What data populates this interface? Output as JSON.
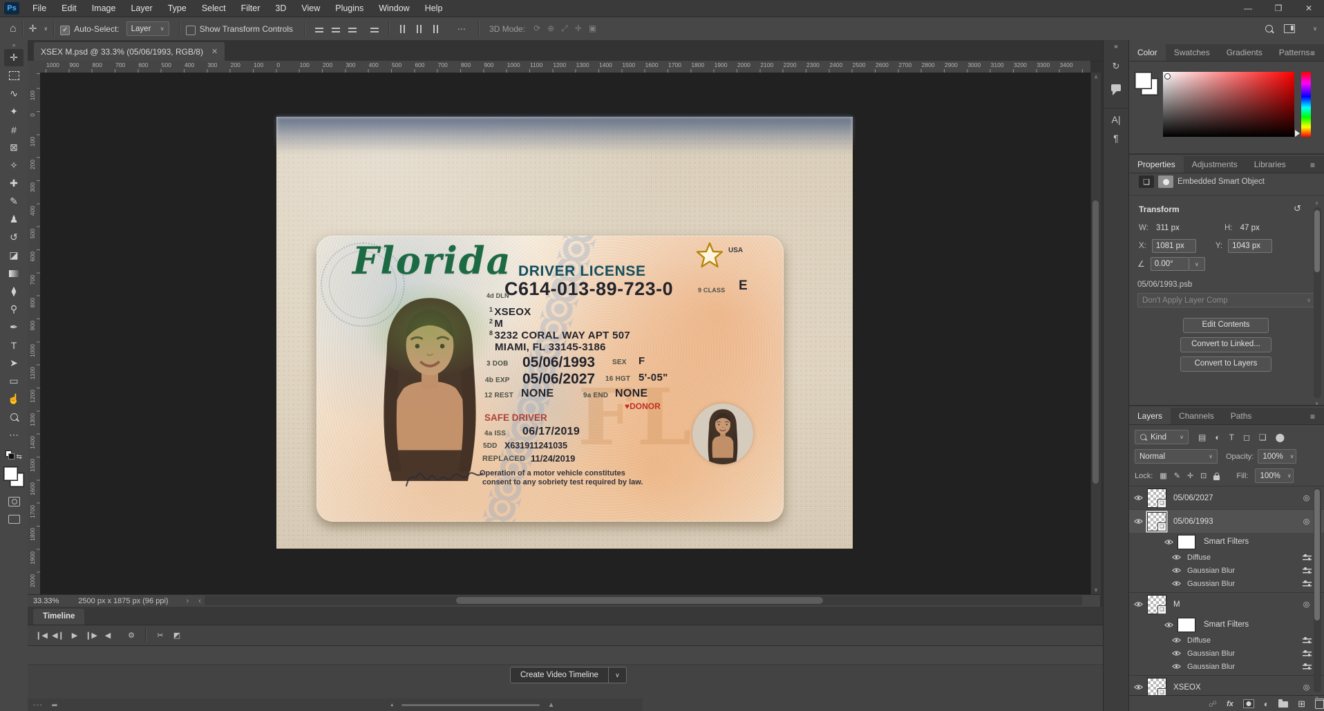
{
  "window": {
    "logo": "Ps",
    "menus": [
      "File",
      "Edit",
      "Image",
      "Layer",
      "Type",
      "Select",
      "Filter",
      "3D",
      "View",
      "Plugins",
      "Window",
      "Help"
    ],
    "controls": [
      "minimize",
      "restore",
      "close"
    ]
  },
  "options_bar": {
    "auto_select": "Auto-Select:",
    "target": "Layer",
    "show_transform": "Show Transform Controls",
    "mode_label": "3D Mode:"
  },
  "doc_tab": "XSEX M.psd @ 33.3% (05/06/1993, RGB/8)",
  "status": {
    "zoom": "33.33%",
    "dims": "2500 px x 1875 px (96 ppi)"
  },
  "rulers": {
    "h": [
      "1000",
      "900",
      "800",
      "700",
      "600",
      "500",
      "400",
      "300",
      "200",
      "100",
      "0",
      "100",
      "200",
      "300",
      "400",
      "500",
      "600",
      "700",
      "800",
      "900",
      "1000",
      "1100",
      "1200",
      "1300",
      "1400",
      "1500",
      "1600",
      "1700",
      "1800",
      "1900",
      "2000",
      "2100",
      "2200",
      "2300",
      "2400",
      "2500",
      "2600",
      "2700",
      "2800",
      "2900",
      "3000",
      "3100",
      "3200",
      "3300",
      "3400"
    ],
    "v": [
      "100",
      "0",
      "100",
      "200",
      "300",
      "400",
      "500",
      "600",
      "700",
      "800",
      "900",
      "1000",
      "1100",
      "1200",
      "1300",
      "1400",
      "1500",
      "1600",
      "1700",
      "1800",
      "1900",
      "2000"
    ]
  },
  "toolbar": {
    "tools": [
      {
        "name": "move-tool-icon",
        "glyph": "✛",
        "active": true
      },
      {
        "name": "marquee-tool-icon",
        "cls": "dashbox"
      },
      {
        "name": "lasso-tool-icon",
        "glyph": "∿"
      },
      {
        "name": "magic-wand-tool-icon",
        "glyph": "✦"
      },
      {
        "name": "crop-tool-icon",
        "glyph": "#"
      },
      {
        "name": "frame-tool-icon",
        "glyph": "⊠"
      },
      {
        "name": "eyedropper-tool-icon",
        "glyph": "✧"
      },
      {
        "name": "healing-brush-tool-icon",
        "glyph": "✚"
      },
      {
        "name": "brush-tool-icon",
        "glyph": "✎"
      },
      {
        "name": "clone-stamp-tool-icon",
        "glyph": "♟"
      },
      {
        "name": "history-brush-tool-icon",
        "glyph": "↺"
      },
      {
        "name": "eraser-tool-icon",
        "glyph": "◪"
      },
      {
        "name": "gradient-tool-icon",
        "cls": "gradchip"
      },
      {
        "name": "blur-tool-icon",
        "glyph": "⧫"
      },
      {
        "name": "dodge-tool-icon",
        "glyph": "⚲"
      },
      {
        "name": "pen-tool-icon",
        "glyph": "✒"
      },
      {
        "name": "type-tool-icon",
        "glyph": "T"
      },
      {
        "name": "path-select-tool-icon",
        "glyph": "➤"
      },
      {
        "name": "shape-tool-icon",
        "glyph": "▭"
      },
      {
        "name": "hand-tool-icon",
        "glyph": "☝"
      },
      {
        "name": "zoom-tool-icon",
        "cls": "mag"
      },
      {
        "name": "more-tools-icon",
        "glyph": "⋯"
      }
    ]
  },
  "timeline": {
    "tab": "Timeline",
    "create": "Create Video Timeline",
    "controls": [
      "first-frame-icon",
      "prev-frame-icon",
      "play-icon",
      "next-frame-icon",
      "audio-mute-icon",
      "settings-gear-icon",
      "split-clip-icon",
      "transition-icon"
    ],
    "control_glyphs": [
      "❙◀",
      "◀❙",
      "▶",
      "❙▶",
      "◀",
      "⚙",
      "✂",
      "◩"
    ]
  },
  "color_panel": {
    "tabs": [
      "Color",
      "Swatches",
      "Gradients",
      "Patterns"
    ],
    "active_tab": "Color"
  },
  "properties_panel": {
    "tabs": [
      "Properties",
      "Adjustments",
      "Libraries"
    ],
    "active_tab": "Properties",
    "object_type": "Embedded Smart Object",
    "section": "Transform",
    "w_label": "W:",
    "w": "311 px",
    "h_label": "H:",
    "h": "47 px",
    "x_label": "X:",
    "x": "1081 px",
    "y_label": "Y:",
    "y": "1043 px",
    "angle": "0.00°",
    "file": "05/06/1993.psb",
    "layer_comp": "Don't Apply Layer Comp",
    "buttons": [
      "Edit Contents",
      "Convert to Linked...",
      "Convert to Layers"
    ]
  },
  "layers_panel": {
    "tabs": [
      "Layers",
      "Channels",
      "Paths"
    ],
    "active_tab": "Layers",
    "kind": "Kind",
    "blend": "Normal",
    "opacity_label": "Opacity:",
    "opacity": "100%",
    "lock_label": "Lock:",
    "fill_label": "Fill:",
    "fill": "100%",
    "filter_icons": [
      "pixel-layer-filter-icon",
      "adjustment-filter-icon",
      "type-filter-icon",
      "shape-filter-icon",
      "smart-object-filter-icon",
      "filter-toggle-icon"
    ],
    "lock_icons": [
      "lock-transparency-icon",
      "lock-pixels-icon",
      "lock-position-icon",
      "lock-artboard-icon",
      "lock-all-icon"
    ],
    "bottom_icons": [
      "link-layers-icon",
      "layer-effects-fx-icon",
      "layer-mask-icon",
      "adjustment-layer-icon",
      "layer-group-icon",
      "new-layer-icon",
      "delete-layer-icon"
    ],
    "rows": [
      {
        "t": "layer",
        "name": "05/06/2027",
        "chev": "∨"
      },
      {
        "t": "layer",
        "name": "05/06/1993",
        "chev": "∧",
        "selected": true
      },
      {
        "t": "sf",
        "name": "Smart Filters"
      },
      {
        "t": "f",
        "name": "Diffuse"
      },
      {
        "t": "f",
        "name": "Gaussian Blur"
      },
      {
        "t": "f",
        "name": "Gaussian Blur"
      },
      {
        "t": "layer",
        "name": "M",
        "chev": "∧",
        "gap": true
      },
      {
        "t": "sf",
        "name": "Smart Filters"
      },
      {
        "t": "f",
        "name": "Diffuse"
      },
      {
        "t": "f",
        "name": "Gaussian Blur"
      },
      {
        "t": "f",
        "name": "Gaussian Blur"
      },
      {
        "t": "layer",
        "name": "XSEOX",
        "chev": "∧",
        "gap": true
      }
    ]
  },
  "rail_icons": [
    "collapse-panels-icon",
    "history-panel-icon",
    "comments-panel-icon",
    "character-panel-icon",
    "paragraph-panel-icon"
  ],
  "license": {
    "state": "Florida",
    "doc_title": "DRIVER LICENSE",
    "usa": "USA",
    "dln_label": "4d DLN",
    "dln": "C614-013-89-723-0",
    "class_label": "9 CLASS",
    "class_value": "E",
    "f1_num": "1",
    "name": "XSEOX",
    "f2_num": "2",
    "middle": "M",
    "f8_num": "8",
    "address1": "3232 CORAL WAY APT 507",
    "address2": "MIAMI, FL 33145-3186",
    "dob_label": "3 DOB",
    "dob": "05/06/1993",
    "sex_label": "SEX",
    "sex": "F",
    "exp_label": "4b EXP",
    "exp": "05/06/2027",
    "hgt_label": "16 HGT",
    "hgt": "5'-05\"",
    "rest_label": "12 REST",
    "rest": "NONE",
    "end_label": "9a END",
    "end": "NONE",
    "donor": "DONOR",
    "safe_driver": "SAFE DRIVER",
    "iss_label": "4a ISS",
    "iss": "06/17/2019",
    "dd_label": "5DD",
    "dd": "X631911241035",
    "replaced_label": "REPLACED",
    "replaced": "11/24/2019",
    "legal_line1": "Operation of a motor vehicle constitutes",
    "legal_line2": "consent to any sobriety test required by law.",
    "fl_watermark": "FL",
    "colors": {
      "state_green": "#1b6a43",
      "title_teal": "#124e5c",
      "safe_red": "#ad4136",
      "donor_red": "#c23020",
      "star_gold": "#b8860b"
    }
  }
}
